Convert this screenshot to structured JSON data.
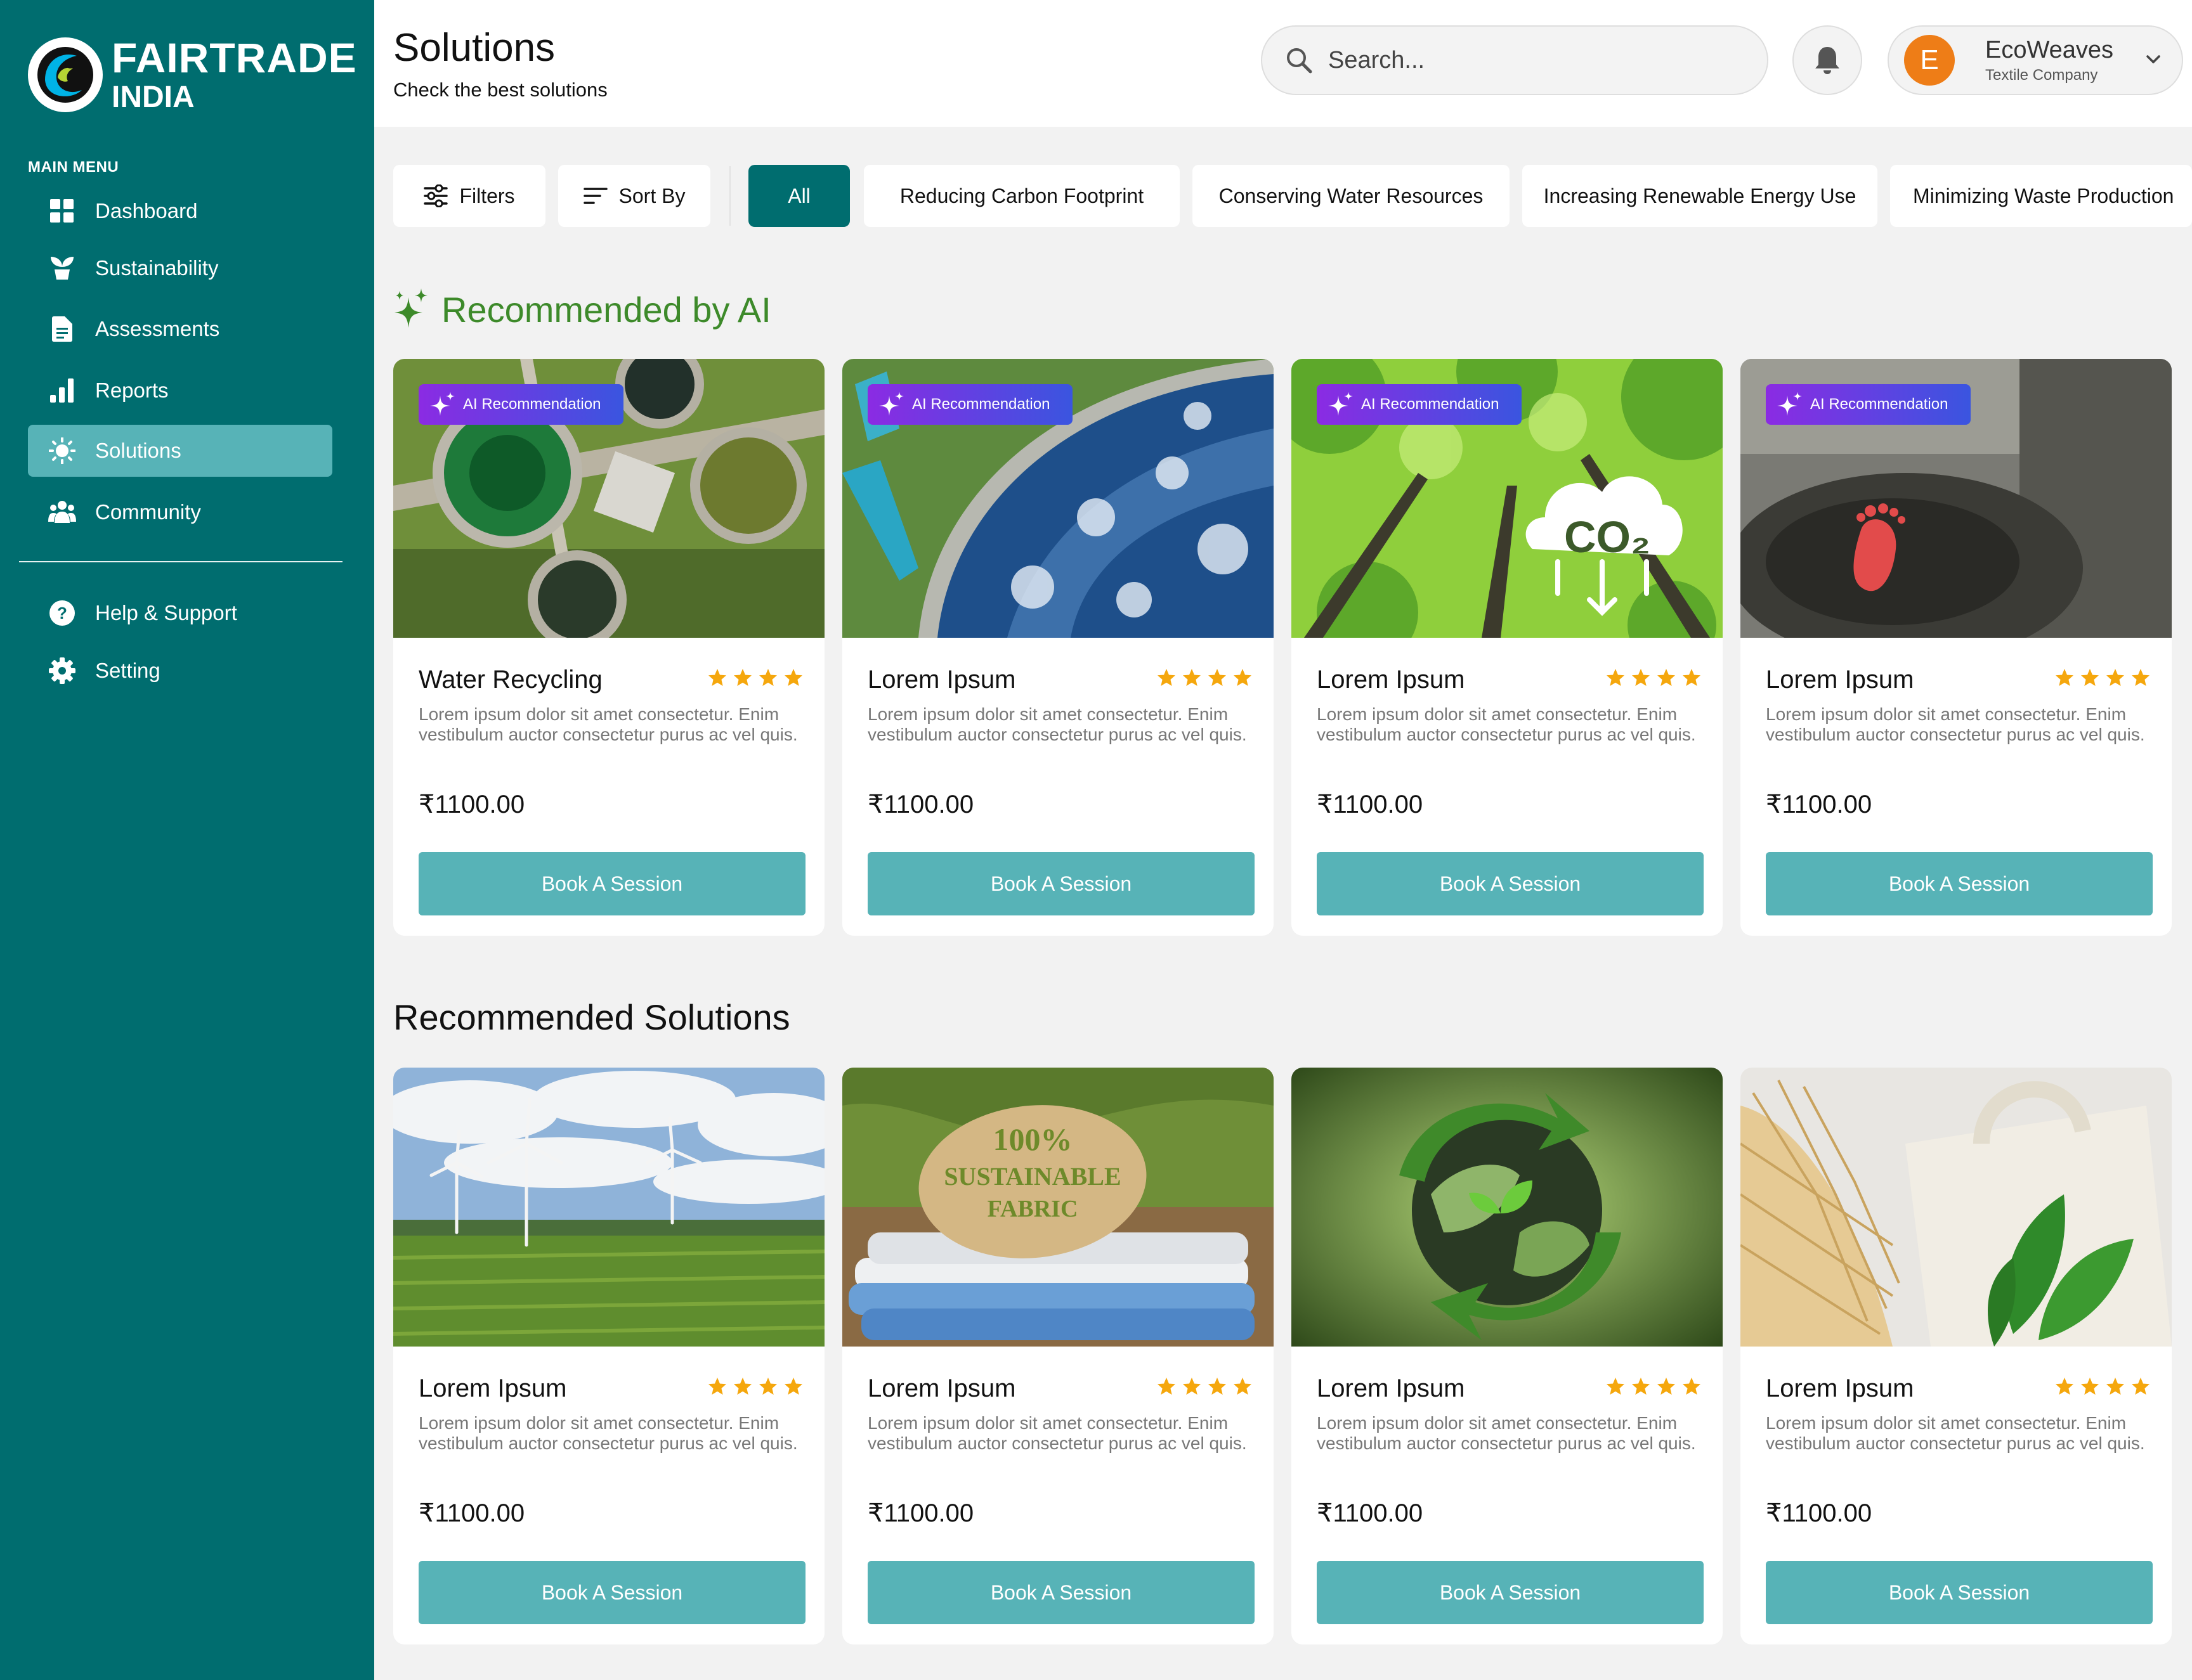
{
  "brand": {
    "line1": "FAIRTRADE",
    "line2": "INDIA"
  },
  "sidebar": {
    "menu_label": "MAIN MENU",
    "items": [
      {
        "label": "Dashboard",
        "icon": "grid-icon"
      },
      {
        "label": "Sustainability",
        "icon": "plant-icon"
      },
      {
        "label": "Assessments",
        "icon": "document-icon"
      },
      {
        "label": "Reports",
        "icon": "bar-chart-icon"
      },
      {
        "label": "Solutions",
        "icon": "sun-icon",
        "active": true
      },
      {
        "label": "Community",
        "icon": "people-icon"
      }
    ],
    "bottom_items": [
      {
        "label": "Help & Support",
        "icon": "help-icon"
      },
      {
        "label": "Setting",
        "icon": "gear-icon"
      }
    ]
  },
  "header": {
    "title": "Solutions",
    "subtitle": "Check the best solutions",
    "search_placeholder": "Search...",
    "user": {
      "initial": "E",
      "name": "EcoWeaves",
      "role": "Textile Company"
    }
  },
  "filters": {
    "filters_label": "Filters",
    "sort_label": "Sort By",
    "chips": [
      "All",
      "Reducing Carbon Footprint",
      "Conserving Water Resources",
      "Increasing Renewable Energy Use",
      "Minimizing Waste Production"
    ],
    "active_chip": "All"
  },
  "colors": {
    "sidebar": "#006d6f",
    "active_nav": "#57b3b7",
    "button": "#57b3b7",
    "ai_title": "#3d8a2a",
    "star": "#f5a70d",
    "avatar": "#ee7d17"
  },
  "ai_section": {
    "title": "Recommended by AI",
    "badge": "AI Recommendation",
    "cards": [
      {
        "title": "Water Recycling",
        "desc": "Lorem ipsum dolor sit amet consectetur. Enim vestibulum auctor consectetur purus ac vel quis.",
        "price": "₹1100.00",
        "button": "Book A Session",
        "rating": 4,
        "image": "water-treatment-plant-image"
      },
      {
        "title": "Lorem Ipsum",
        "desc": "Lorem ipsum dolor sit amet consectetur. Enim vestibulum auctor consectetur purus ac vel quis.",
        "price": "₹1100.00",
        "button": "Book A Session",
        "rating": 4,
        "image": "water-tank-aerial-image"
      },
      {
        "title": "Lorem Ipsum",
        "desc": "Lorem ipsum dolor sit amet consectetur. Enim vestibulum auctor consectetur purus ac vel quis.",
        "price": "₹1100.00",
        "button": "Book A Session",
        "rating": 4,
        "image": "forest-co2-cloud-image",
        "image_text": "CO₂"
      },
      {
        "title": "Lorem Ipsum",
        "desc": "Lorem ipsum dolor sit amet consectetur. Enim vestibulum auctor consectetur purus ac vel quis.",
        "price": "₹1100.00",
        "button": "Book A Session",
        "rating": 4,
        "image": "tree-stump-footprint-image"
      }
    ]
  },
  "rec_section": {
    "title": "Recommended Solutions",
    "cards": [
      {
        "title": "Lorem Ipsum",
        "desc": "Lorem ipsum dolor sit amet consectetur. Enim vestibulum auctor consectetur purus ac vel quis.",
        "price": "₹1100.00",
        "button": "Book A Session",
        "rating": 4,
        "image": "wind-turbines-field-image"
      },
      {
        "title": "Lorem Ipsum",
        "desc": "Lorem ipsum dolor sit amet consectetur. Enim vestibulum auctor consectetur purus ac vel quis.",
        "price": "₹1100.00",
        "button": "Book A Session",
        "rating": 4,
        "image": "sustainable-fabric-tag-image",
        "image_text": [
          "100%",
          "SUSTAINABLE",
          "FABRIC"
        ]
      },
      {
        "title": "Lorem Ipsum",
        "desc": "Lorem ipsum dolor sit amet consectetur. Enim vestibulum auctor consectetur purus ac vel quis.",
        "price": "₹1100.00",
        "button": "Book A Session",
        "rating": 4,
        "image": "recycle-globe-image"
      },
      {
        "title": "Lorem Ipsum",
        "desc": "Lorem ipsum dolor sit amet consectetur. Enim vestibulum auctor consectetur purus ac vel quis.",
        "price": "₹1100.00",
        "button": "Book A Session",
        "rating": 4,
        "image": "tote-bags-leaf-image"
      }
    ]
  }
}
